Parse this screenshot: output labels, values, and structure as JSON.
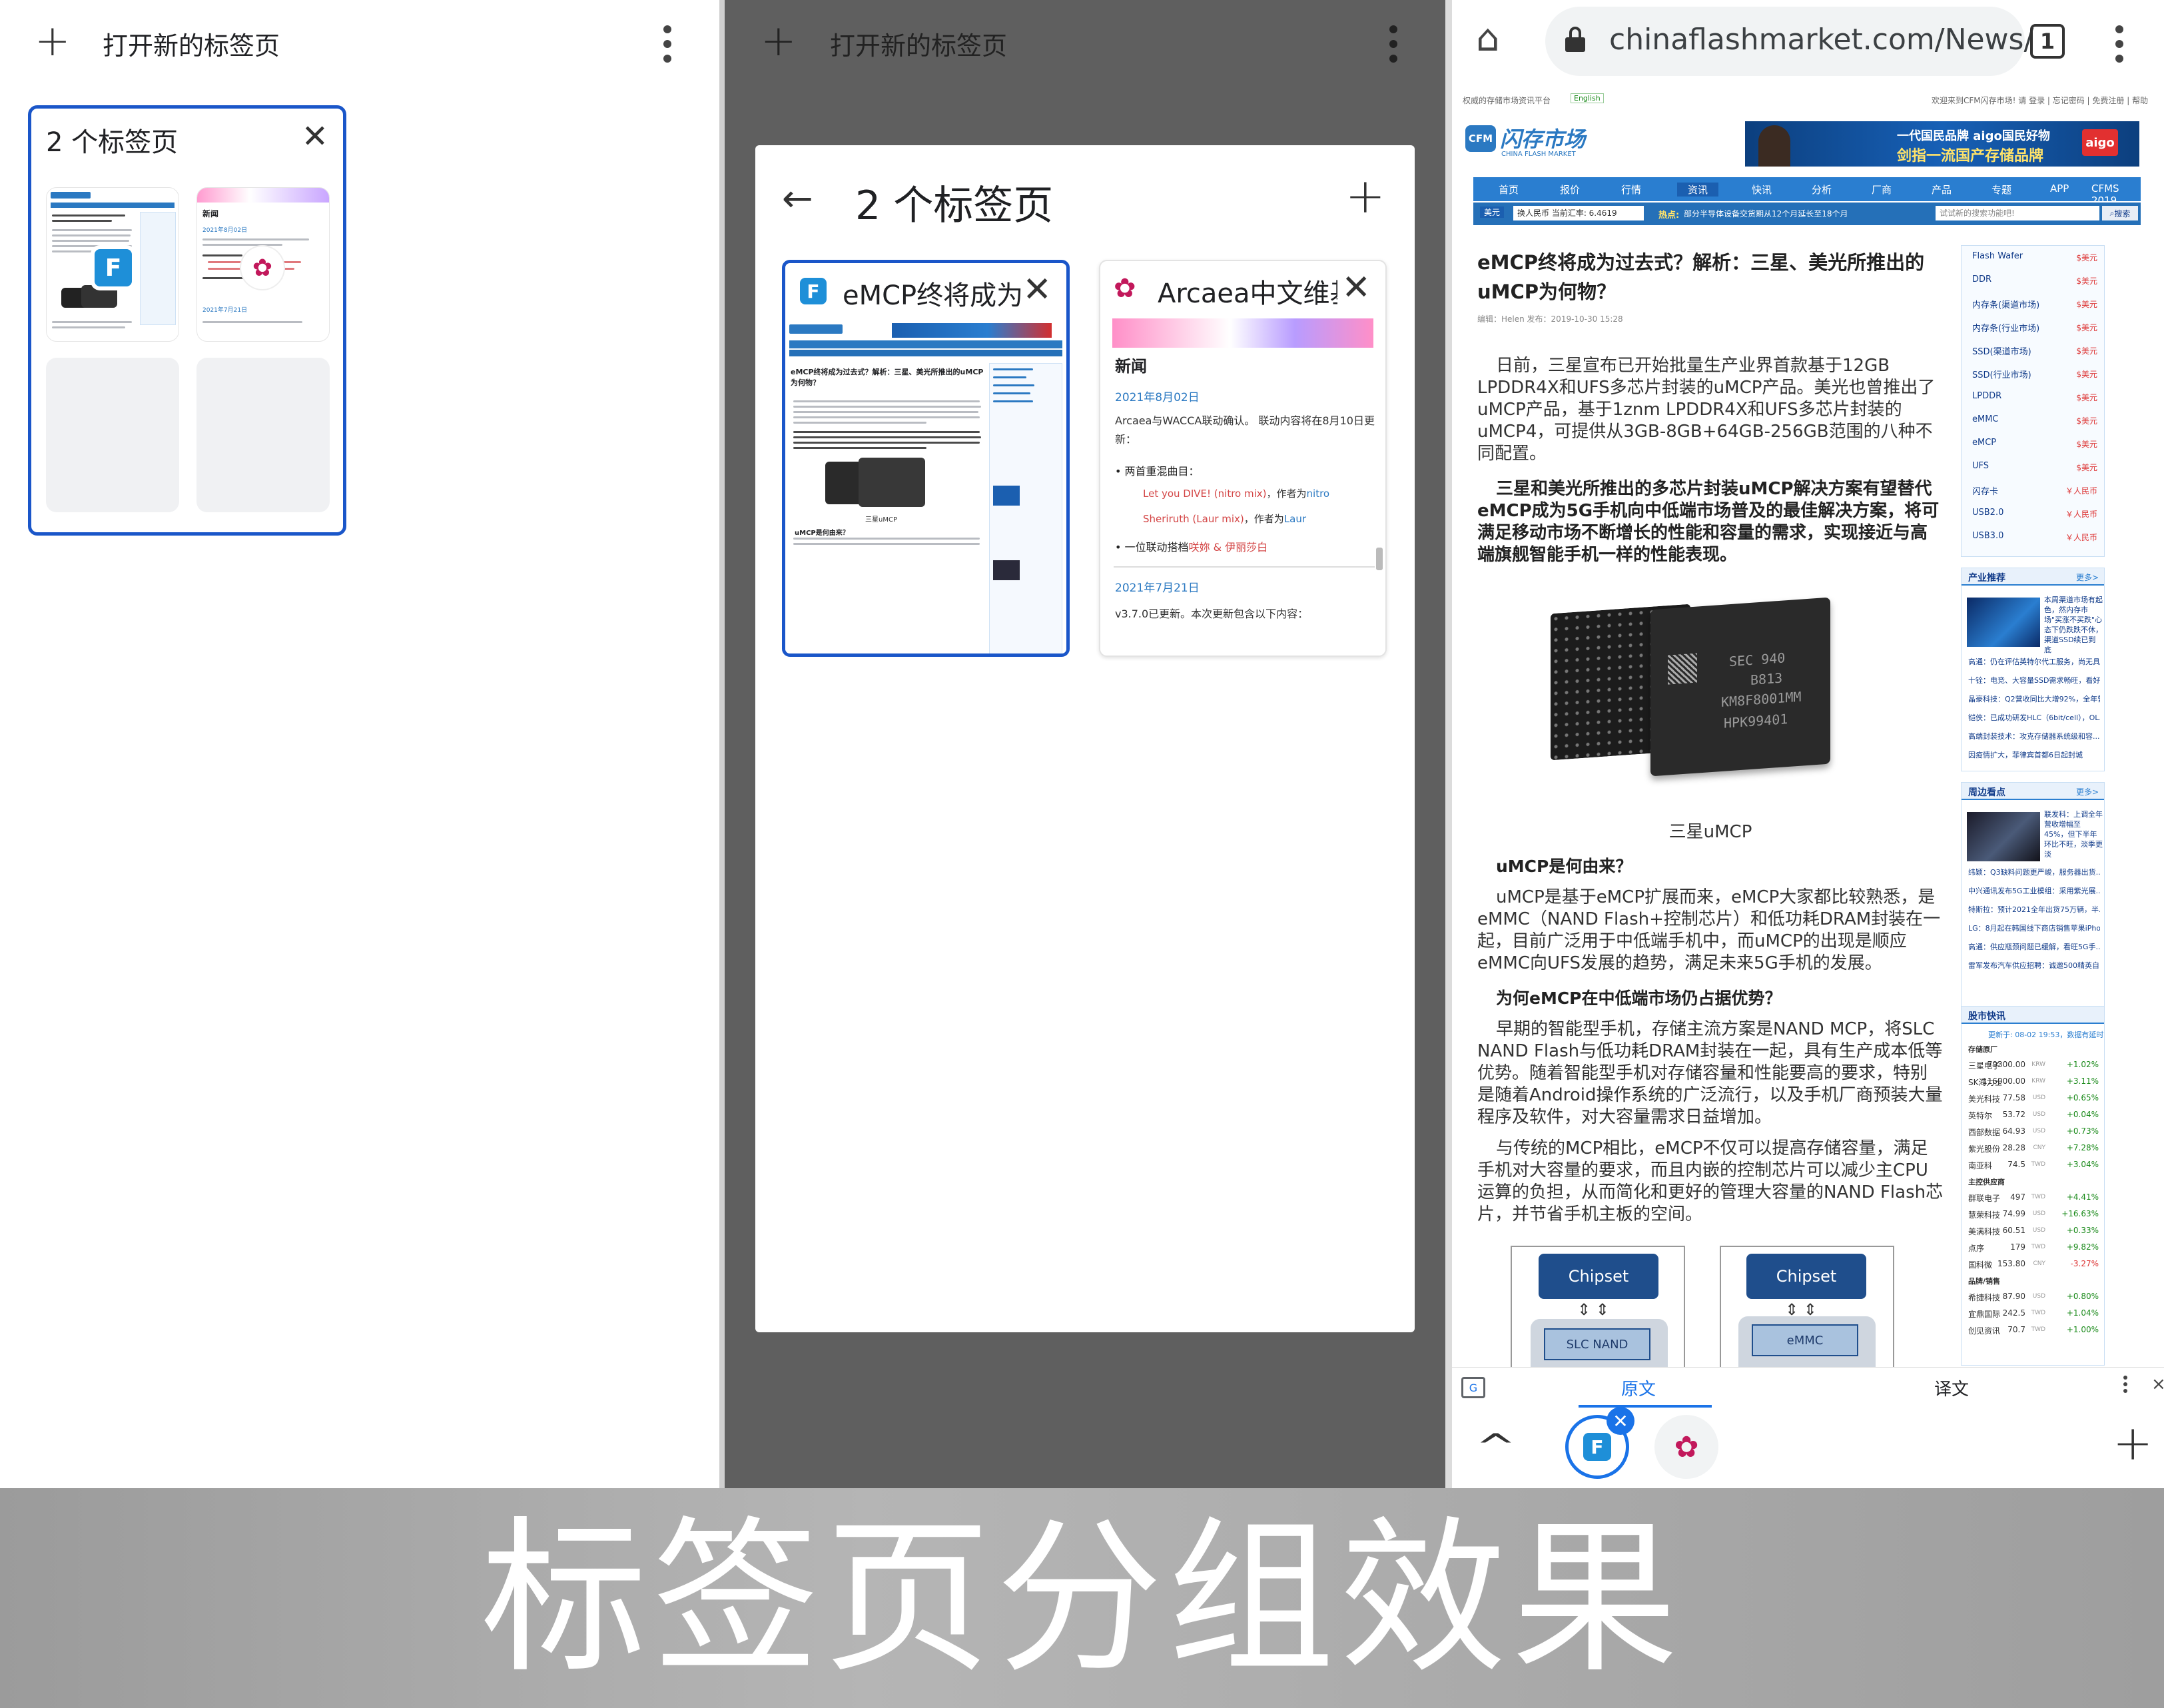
{
  "p1": {
    "new_tab_label": "打开新的标签页",
    "group_title": "2 个标签页",
    "mini": {
      "news_heading": "新闻",
      "date1": "2021年8月02日",
      "date2": "2021年7月21日"
    }
  },
  "p2": {
    "new_tab_label": "打开新的标签页",
    "sheet_title": "2 个标签页",
    "tab1": {
      "title": "eMCP终将成为",
      "preview_heading": "eMCP终将成为过去式？解析：三星、美光所推出的uMCP为何物？",
      "caption": "三星uMCP",
      "sub": "uMCP是何由来？"
    },
    "tab2": {
      "title": "Arcaea中文维基",
      "news": "新闻",
      "date1": "2021年8月02日",
      "p1": "Arcaea与WACCA联动确认。 联动内容将在8月10日更新：",
      "b1": "• 两首重混曲目：",
      "s1a": "Let you DIVE! (nitro mix)",
      "s1b": "，作者为",
      "s1c": "nitro",
      "s2a": "Sheriruth (Laur mix)",
      "s2b": "，作者为",
      "s2c": "Laur",
      "b2a": "• 一位联动搭档",
      "b2b": "咲妳 & 伊丽莎白",
      "date2": "2021年7月21日",
      "p2": "v3.7.0已更新。本次更新包含以下内容："
    }
  },
  "p3": {
    "url": "chinaflashmarket.com/News/",
    "tab_count": "1",
    "site": {
      "tagline": "权威的存储市场资讯平台",
      "lang": "English",
      "welcome": "欢迎来到CFM闪存市场! 请 登录 | 忘记密码 | 免费注册 | 帮助",
      "logo_cn": "闪存市场",
      "logo_en": "CHINA FLASH MARKET",
      "logo_mark": "CFM",
      "banner_line1": "一代国民品牌 aigo国民好物",
      "banner_line2": "剑指一流国产存储品牌",
      "banner_brand": "aigo",
      "nav": [
        "首页",
        "报价",
        "行情",
        "资讯",
        "快讯",
        "分析",
        "厂商",
        "产品",
        "专题",
        "APP",
        "CFMS 2019"
      ],
      "rate_label": "美元",
      "rate_text": "换人民币 当前汇率: 6.4619",
      "hot_label": "热点:",
      "hot_text": "部分半导体设备交货期从12个月延长至18个月",
      "search_placeholder": "试试新的搜索功能吧!",
      "search_btn": "搜索"
    },
    "article": {
      "title": "eMCP终将成为过去式？解析：三星、美光所推出的uMCP为何物？",
      "meta": "编辑：Helen 发布：2019-10-30 15:28",
      "p1": "日前，三星宣布已开始批量生产业界首款基于12GB LPDDR4X和UFS多芯片封装的uMCP产品。美光也曾推出了uMCP产品，基于1znm LPDDR4X和UFS多芯片封装的uMCP4，可提供从3GB-8GB+64GB-256GB范围的八种不同配置。",
      "p2": "三星和美光所推出的多芯片封装uMCP解决方案有望替代eMCP成为5G手机向中低端市场普及的最佳解决方案，将可满足移动市场不断增长的性能和容量的需求，实现接近与高端旗舰智能手机一样的性能表现。",
      "chip_text1": "SEC 940",
      "chip_text2": "B813",
      "chip_text3": "KM8F8001MM",
      "chip_text4": "HPK99401",
      "caption": "三星uMCP",
      "h1": "uMCP是何由来？",
      "p3": "uMCP是基于eMCP扩展而来，eMCP大家都比较熟悉，是eMMC（NAND Flash+控制芯片）和低功耗DRAM封装在一起，目前广泛用于中低端手机中，而uMCP的出现是顺应eMMC向UFS发展的趋势，满足未来5G手机的发展。",
      "h2": "为何eMCP在中低端市场仍占据优势？",
      "p4": "早期的智能型手机，存储主流方案是NAND MCP，将SLC NAND Flash与低功耗DRAM封装在一起，具有生产成本低等优势。随着智能型手机对存储容量和性能要高的要求，特别是随着Android操作系统的广泛流行，以及手机厂商预装大量程序及软件，对大容量需求日益增加。",
      "p5": "与传统的MCP相比，eMCP不仅可以提高存储容量，满足手机对大容量的要求，而且内嵌的控制芯片可以减少主CPU运算的负担，从而简化和更好的管理大容量的NAND Flash芯片，并节省手机主板的空间。",
      "diag_chipset": "Chipset",
      "diag_slc": "SLC NAND",
      "diag_emmc": "eMMC"
    },
    "prices": [
      {
        "name": "Flash Wafer",
        "unit": "$美元"
      },
      {
        "name": "DDR",
        "unit": "$美元"
      },
      {
        "name": "内存条(渠道市场)",
        "unit": "$美元"
      },
      {
        "name": "内存条(行业市场)",
        "unit": "$美元"
      },
      {
        "name": "SSD(渠道市场)",
        "unit": "$美元"
      },
      {
        "name": "SSD(行业市场)",
        "unit": "$美元"
      },
      {
        "name": "LPDDR",
        "unit": "$美元"
      },
      {
        "name": "eMMC",
        "unit": "$美元"
      },
      {
        "name": "eMCP",
        "unit": "$美元"
      },
      {
        "name": "UFS",
        "unit": "$美元"
      },
      {
        "name": "闪存卡",
        "unit": "￥人民币"
      },
      {
        "name": "USB2.0",
        "unit": "￥人民币"
      },
      {
        "name": "USB3.0",
        "unit": "￥人民币"
      }
    ],
    "rec": {
      "title": "产业推荐",
      "more": "更多>",
      "lead": "本周渠道市场有起色，然内存市场\"买涨不买跌\"心态下仍跌跌不休，渠道SSD续已到底",
      "items": [
        "高通：仍在评估英特尔代工服务，尚无具...",
        "十铨：电竞、大容量SSD需求畅旺，看好...",
        "晶豪科技：Q2营收同比大增92%，全年营...",
        "铠侠：已成功研发HLC（6bit/cell），OL...",
        "高端封装技术：攻克存储器系统级和容...",
        "因疫情扩大，菲律宾首都6日起封城"
      ]
    },
    "around": {
      "title": "周边看点",
      "more": "更多>",
      "lead": "联发科：上调全年营收增幅至45%，但下半年环比不旺，淡季更淡",
      "items": [
        "纬颖：Q3缺料问题更严峻，服务器出货...",
        "中兴通讯发布5G工业模组：采用紫光展...",
        "特斯拉：预计2021全年出货75万辆，半...",
        "LG：8月起在韩国线下商店销售苹果iPho...",
        "高通：供应瓶颈问题已缓解，看旺5G手...",
        "雷军发布汽车供应招聘：诚邀500精英自..."
      ]
    },
    "stocks": {
      "title": "股市快讯",
      "updated": "更新于: 08-02 19:53，数据有延时",
      "groups": [
        {
          "name": "存储原厂",
          "rows": [
            {
              "n": "三星电子",
              "v": "79300.00",
              "c": "KRW",
              "d": "+1.02%"
            },
            {
              "n": "SK海力士",
              "v": "116000.00",
              "c": "KRW",
              "d": "+3.11%"
            },
            {
              "n": "美光科技",
              "v": "77.58",
              "c": "USD",
              "d": "+0.65%"
            },
            {
              "n": "英特尔",
              "v": "53.72",
              "c": "USD",
              "d": "+0.04%"
            },
            {
              "n": "西部数据",
              "v": "64.93",
              "c": "USD",
              "d": "+0.73%"
            },
            {
              "n": "紫光股份",
              "v": "28.28",
              "c": "CNY",
              "d": "+7.28%"
            },
            {
              "n": "南亚科",
              "v": "74.5",
              "c": "TWD",
              "d": "+3.04%"
            }
          ]
        },
        {
          "name": "主控供应商",
          "rows": [
            {
              "n": "群联电子",
              "v": "497",
              "c": "TWD",
              "d": "+4.41%"
            },
            {
              "n": "慧荣科技",
              "v": "74.99",
              "c": "USD",
              "d": "+16.63%"
            },
            {
              "n": "美满科技",
              "v": "60.51",
              "c": "USD",
              "d": "+0.33%"
            },
            {
              "n": "点序",
              "v": "179",
              "c": "TWD",
              "d": "+9.82%"
            },
            {
              "n": "国科微",
              "v": "153.80",
              "c": "CNY",
              "d": "-3.27%"
            }
          ]
        },
        {
          "name": "品牌/销售",
          "rows": [
            {
              "n": "希捷科技",
              "v": "87.90",
              "c": "USD",
              "d": "+0.80%"
            },
            {
              "n": "宜鼎国际",
              "v": "242.5",
              "c": "TWD",
              "d": "+1.04%"
            },
            {
              "n": "创见资讯",
              "v": "70.7",
              "c": "TWD",
              "d": "+1.00%"
            }
          ]
        }
      ]
    },
    "translate": {
      "original": "原文",
      "translated": "译文"
    }
  },
  "caption": "标签页分组效果"
}
